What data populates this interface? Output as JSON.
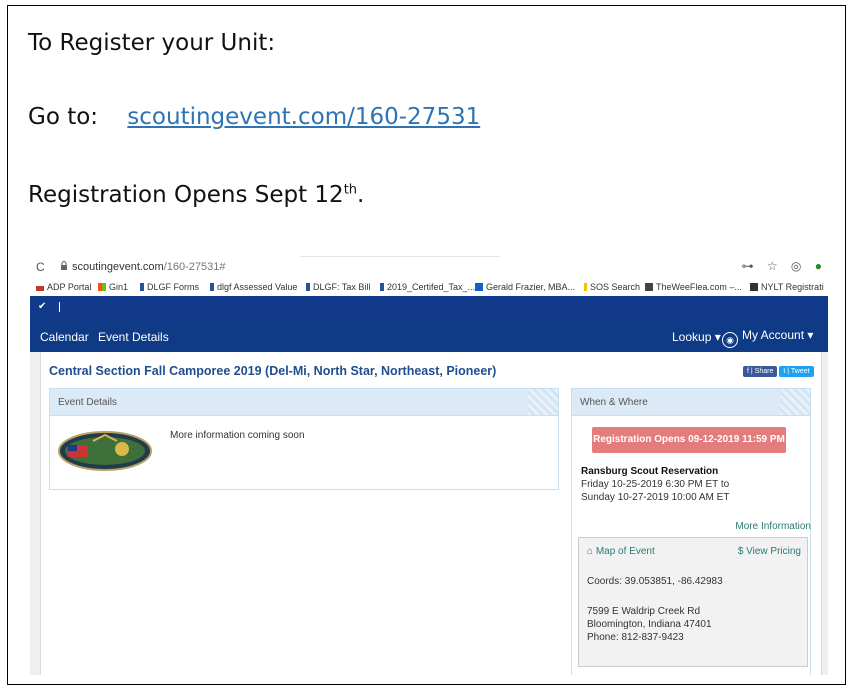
{
  "doc": {
    "line1": "To Register your Unit:",
    "line2_prefix": "Go to:",
    "line2_link": "scoutingevent.com/160-27531",
    "line3_main": "Registration Opens Sept 12",
    "line3_sup": "th",
    "line3_end": "."
  },
  "browser": {
    "url_host": "scoutingevent.com",
    "url_path": "/160-27531#",
    "bookmarks": [
      {
        "label": "ADP Portal",
        "color": "#c0392b"
      },
      {
        "label": "Gin1",
        "color": "#f0a030"
      },
      {
        "label": "DLGF Forms",
        "color": "#2b4fa0"
      },
      {
        "label": "dlgf Assessed Value",
        "color": "#2b4fa0"
      },
      {
        "label": "DLGF: Tax Bill",
        "color": "#2b4fa0"
      },
      {
        "label": "2019_Certifed_Tax_...",
        "color": "#2b4fa0"
      },
      {
        "label": "Gerald Frazier, MBA...",
        "color": "#0a66c2"
      },
      {
        "label": "SOS Search",
        "color": "#f2c200"
      },
      {
        "label": "TheWeeFlea.com –...",
        "color": "#444444"
      },
      {
        "label": "NYLT Registrati",
        "color": "#333333"
      }
    ]
  },
  "nav": {
    "calendar": "Calendar",
    "event_details": "Event Details",
    "lookup": "Lookup ▾",
    "my_account": "My Account ▾"
  },
  "event": {
    "title": "Central Section Fall Camporee 2019 (Del-Mi, North Star, Northeast, Pioneer)",
    "share_label": "f | Share",
    "tweet_label": "t | Tweet",
    "details_header": "Event Details",
    "more_info_text": "More information coming soon",
    "when_where_header": "When & Where",
    "registration_button": "Registration Opens 09-12-2019 11:59 PM",
    "location_name": "Ransburg Scout Reservation",
    "start": "Friday 10-25-2019 6:30 PM ET to",
    "end": "Sunday 10-27-2019 10:00 AM ET",
    "more_information_link": "More Information",
    "map_link": "Map of Event",
    "pricing_link": "$ View Pricing",
    "coords": "Coords: 39.053851, -86.42983",
    "address_line1": "7599 E Waldrip Creek Rd",
    "address_line2": "Bloomington, Indiana 47401",
    "phone": "Phone: 812-837-9423"
  },
  "colors": {
    "nav_bg": "#0f3b86",
    "title_blue": "#1f4d8f",
    "reg_button": "#e47c7c",
    "teal_link": "#2a7a73"
  }
}
